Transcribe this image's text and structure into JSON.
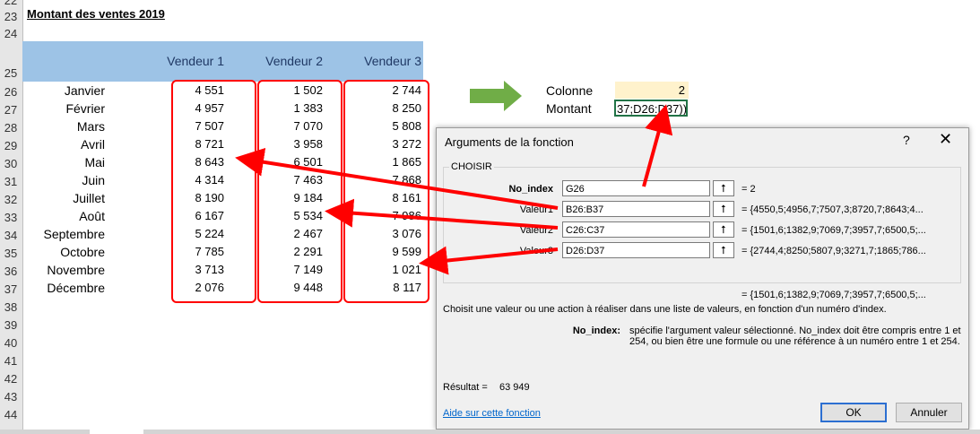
{
  "sheet": {
    "row_numbers": [
      "22",
      "23",
      "24",
      "25",
      "26",
      "27",
      "28",
      "29",
      "30",
      "31",
      "32",
      "33",
      "34",
      "35",
      "36",
      "37",
      "38",
      "39",
      "40",
      "41",
      "42",
      "43",
      "44"
    ],
    "title": "Montant des ventes 2019",
    "vendor_headers": [
      "Vendeur 1",
      "Vendeur 2",
      "Vendeur 3"
    ],
    "months": [
      "Janvier",
      "Février",
      "Mars",
      "Avril",
      "Mai",
      "Juin",
      "Juillet",
      "Août",
      "Septembre",
      "Octobre",
      "Novembre",
      "Décembre"
    ],
    "v1": [
      "4 551",
      "4 957",
      "7 507",
      "8 721",
      "8 643",
      "4 314",
      "8 190",
      "6 167",
      "5 224",
      "7 785",
      "3 713",
      "2 076"
    ],
    "v2": [
      "1 502",
      "1 383",
      "7 070",
      "3 958",
      "6 501",
      "7 463",
      "9 184",
      "5 534",
      "2 467",
      "2 291",
      "7 149",
      "9 448"
    ],
    "v3": [
      "2 744",
      "8 250",
      "5 808",
      "3 272",
      "1 865",
      "7 868",
      "8 161",
      "7 986",
      "3 076",
      "9 599",
      "1 021",
      "8 117"
    ],
    "colonne_label": "Colonne",
    "colonne_value": "2",
    "montant_label": "Montant",
    "montant_formula": "37;D26:D37))"
  },
  "dialog": {
    "title": "Arguments de la fonction",
    "help": "?",
    "close": "✕",
    "function_name": "CHOISIR",
    "args": [
      {
        "label": "No_index",
        "value": "G26",
        "result": "= 2"
      },
      {
        "label": "Valeur1",
        "value": "B26:B37",
        "result": "= {4550,5;4956,7;7507,3;8720,7;8643;4..."
      },
      {
        "label": "Valeur2",
        "value": "C26:C37",
        "result": "= {1501,6;1382,9;7069,7;3957,7;6500,5;..."
      },
      {
        "label": "Valeur3",
        "value": "D26:D37",
        "result": "= {2744,4;8250;5807,9;3271,7;1865;786..."
      }
    ],
    "formula_result": "= {1501,6;1382,9;7069,7;3957,7;6500,5;...",
    "description": "Choisit une valeur ou une action à réaliser dans une liste de valeurs, en fonction d'un numéro d'index.",
    "param_name": "No_index:",
    "param_desc": "spécifie l'argument valeur sélectionné. No_index doit être compris entre 1 et 254, ou bien être une formule ou une référence à un numéro entre 1 et 254.",
    "result_label": "Résultat =",
    "result_value": "63 949",
    "help_link": "Aide sur cette fonction",
    "ok": "OK",
    "cancel": "Annuler"
  },
  "colors": {
    "header_band": "#9dc3e6",
    "red": "#ff0000",
    "green_arrow": "#70ad47",
    "cell_highlight": "#fff2cc"
  }
}
